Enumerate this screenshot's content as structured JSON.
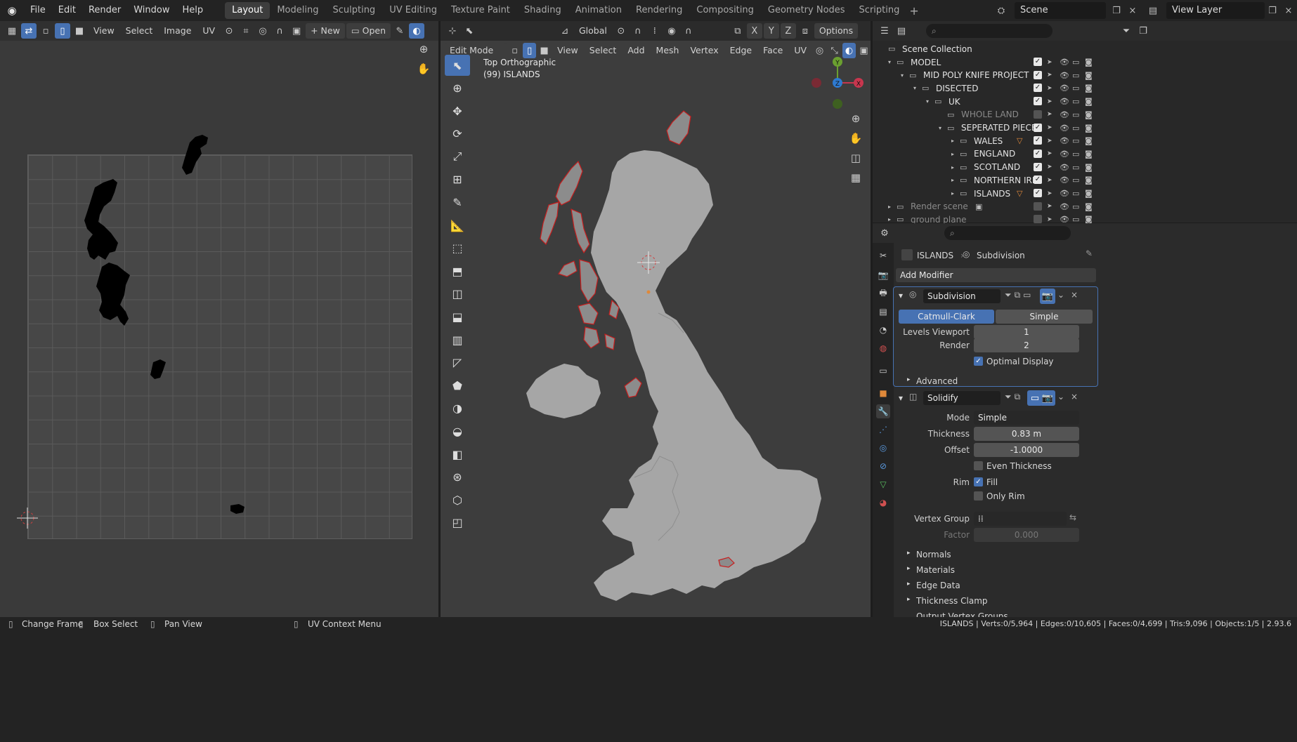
{
  "topbar": {
    "menus": [
      "File",
      "Edit",
      "Render",
      "Window",
      "Help"
    ],
    "workspaces": [
      "Layout",
      "Modeling",
      "Sculpting",
      "UV Editing",
      "Texture Paint",
      "Shading",
      "Animation",
      "Rendering",
      "Compositing",
      "Geometry Nodes",
      "Scripting"
    ],
    "active_workspace": "Layout",
    "scene": "Scene",
    "view_layer": "View Layer"
  },
  "uv_editor": {
    "menus": [
      "View",
      "Select",
      "Image",
      "UV"
    ],
    "new_label": "New",
    "open_label": "Open"
  },
  "viewport": {
    "mode": "Edit Mode",
    "menus": [
      "View",
      "Select",
      "Add",
      "Mesh",
      "Vertex",
      "Edge",
      "Face",
      "UV"
    ],
    "orientation": "Global",
    "options": "Options",
    "view_name": "Top Orthographic",
    "object_label": "(99) ISLANDS",
    "axes": {
      "y": "Y",
      "z": "Z",
      "x": "X"
    }
  },
  "outliner": {
    "root": "Scene Collection",
    "rows": [
      "MODEL",
      "MID POLY KNIFE PROJECT",
      "DISECTED",
      "UK",
      "WHOLE LAND",
      "SEPERATED PIECES",
      "WALES",
      "ENGLAND",
      "SCOTLAND",
      "NORTHERN IRE",
      "ISLANDS",
      "Render scene",
      "ground plane"
    ]
  },
  "properties": {
    "object": "ISLANDS",
    "modifier_breadcrumb": "Subdivision",
    "add_modifier": "Add Modifier",
    "subdivision": {
      "name": "Subdivision",
      "mode_a": "Catmull-Clark",
      "mode_b": "Simple",
      "levels_viewport_label": "Levels Viewport",
      "levels_viewport": "1",
      "render_label": "Render",
      "render": "2",
      "optimal_display": "Optimal Display",
      "advanced": "Advanced"
    },
    "solidify": {
      "name": "Solidify",
      "mode_label": "Mode",
      "mode": "Simple",
      "thickness_label": "Thickness",
      "thickness": "0.83 m",
      "offset_label": "Offset",
      "offset": "-1.0000",
      "even_thickness": "Even Thickness",
      "rim_label": "Rim",
      "fill": "Fill",
      "only_rim": "Only Rim",
      "vertex_group_label": "Vertex Group",
      "factor_label": "Factor",
      "factor": "0.000",
      "sections": [
        "Normals",
        "Materials",
        "Edge Data",
        "Thickness Clamp",
        "Output Vertex Groups"
      ]
    }
  },
  "status": {
    "change_frame": "Change Frame",
    "box_select": "Box Select",
    "pan_view": "Pan View",
    "uv_context": "UV Context Menu",
    "stats": "ISLANDS | Verts:0/5,964 | Edges:0/10,605 | Faces:0/4,699 | Tris:9,096 | Objects:1/5 | 2.93.6"
  },
  "colors": {
    "accent": "#4772b3",
    "wales_icon": "#e0893a",
    "selection_red": "#c81e1e"
  }
}
